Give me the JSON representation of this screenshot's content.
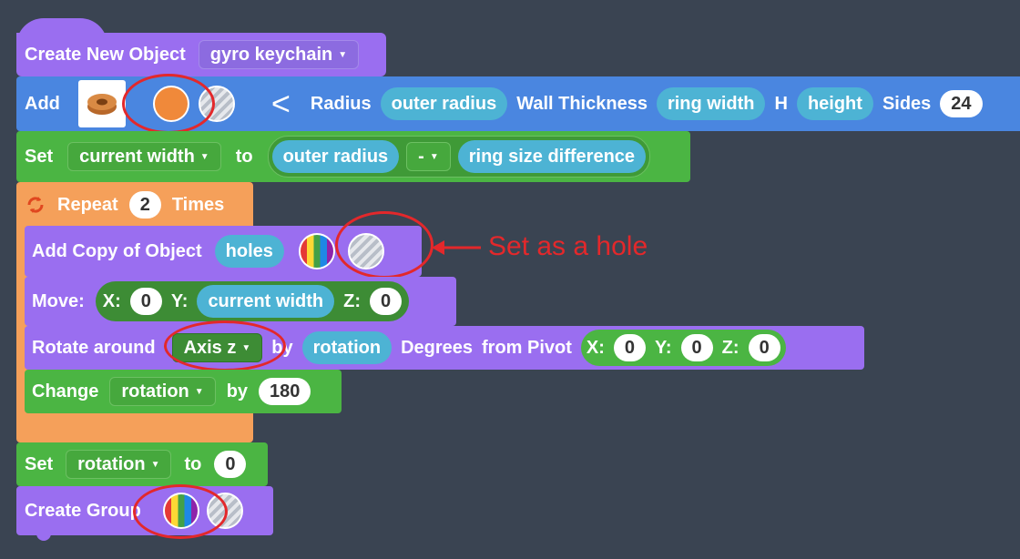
{
  "colors": {
    "background": "#3a4452",
    "purple": "#9a6ef0",
    "blue": "#4a86e0",
    "green": "#4bb543",
    "orange": "#f5a05a",
    "annotation_red": "#e3282b"
  },
  "create_object": {
    "label": "Create New Object",
    "name": "gyro keychain"
  },
  "add_block": {
    "label": "Add",
    "back_glyph": "<",
    "radius_label": "Radius",
    "radius_value": "outer radius",
    "wall_label": "Wall Thickness",
    "wall_value": "ring width",
    "h_label": "H",
    "h_value": "height",
    "sides_label": "Sides",
    "sides_value": "24"
  },
  "set_width": {
    "label": "Set",
    "variable": "current width",
    "to_label": "to",
    "left": "outer radius",
    "operator": "-",
    "right": "ring size difference"
  },
  "repeat": {
    "label": "Repeat",
    "count": "2",
    "times_label": "Times"
  },
  "add_copy": {
    "label": "Add Copy of Object",
    "object": "holes"
  },
  "move": {
    "label": "Move:",
    "x_label": "X:",
    "x_value": "0",
    "y_label": "Y:",
    "y_value": "current width",
    "z_label": "Z:",
    "z_value": "0"
  },
  "rotate": {
    "label": "Rotate around",
    "axis": "Axis z",
    "by_label": "by",
    "amount": "rotation",
    "degrees_label": "Degrees",
    "pivot_label": "from Pivot",
    "x_label": "X:",
    "x_value": "0",
    "y_label": "Y:",
    "y_value": "0",
    "z_label": "Z:",
    "z_value": "0"
  },
  "change": {
    "label": "Change",
    "variable": "rotation",
    "by_label": "by",
    "value": "180"
  },
  "set_rotation": {
    "label": "Set",
    "variable": "rotation",
    "to_label": "to",
    "value": "0"
  },
  "create_group": {
    "label": "Create Group"
  },
  "annotation": {
    "text": "Set as a hole"
  }
}
